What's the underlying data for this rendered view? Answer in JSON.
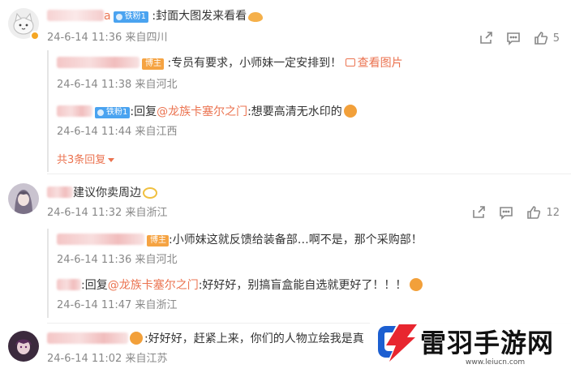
{
  "comments": [
    {
      "user_end": "a",
      "badge": "铁粉1",
      "text": ":封面大图发来看看",
      "meta": "24-6-14 11:36 来自四川",
      "likes": "5",
      "replies": [
        {
          "badge": "博主",
          "text": ":专员有要求，小师妹一定安排到！",
          "link": "查看图片",
          "meta": "24-6-14 11:38 来自河北"
        },
        {
          "badge": "铁粉1",
          "text_prefix": ":回复",
          "mention": "@龙族卡塞尔之门",
          "text": ":想要高清无水印的",
          "meta": "24-6-14 11:44 来自江西"
        }
      ],
      "more": "共3条回复"
    },
    {
      "text": "建议你卖周边",
      "meta": "24-6-14 11:32 来自浙江",
      "likes": "12",
      "replies": [
        {
          "badge": "博主",
          "text": ":小师妹这就反馈给装备部…啊不是，那个采购部！",
          "meta": "24-6-14 11:36 来自河北"
        },
        {
          "text_prefix": ":回复",
          "mention": "@龙族卡塞尔之门",
          "text": ":好好好，别搞盲盒能自选就更好了！！！",
          "meta": "24-6-14 11:47 来自浙江"
        }
      ]
    },
    {
      "text": ":好好好，赶紧上来，你们的人物立绘我是真",
      "meta": "24-6-14 11:02 来自江苏"
    }
  ],
  "watermark": {
    "title": "雷羽手游网",
    "url": "www.leiucn.com"
  },
  "icons": {
    "share": "share-icon",
    "comment": "comment-icon",
    "like": "like-icon"
  },
  "colors": {
    "accent": "#eb7350",
    "badge_blue": "#4aa3f0",
    "badge_orange": "#f5a342",
    "muted": "#888888"
  }
}
